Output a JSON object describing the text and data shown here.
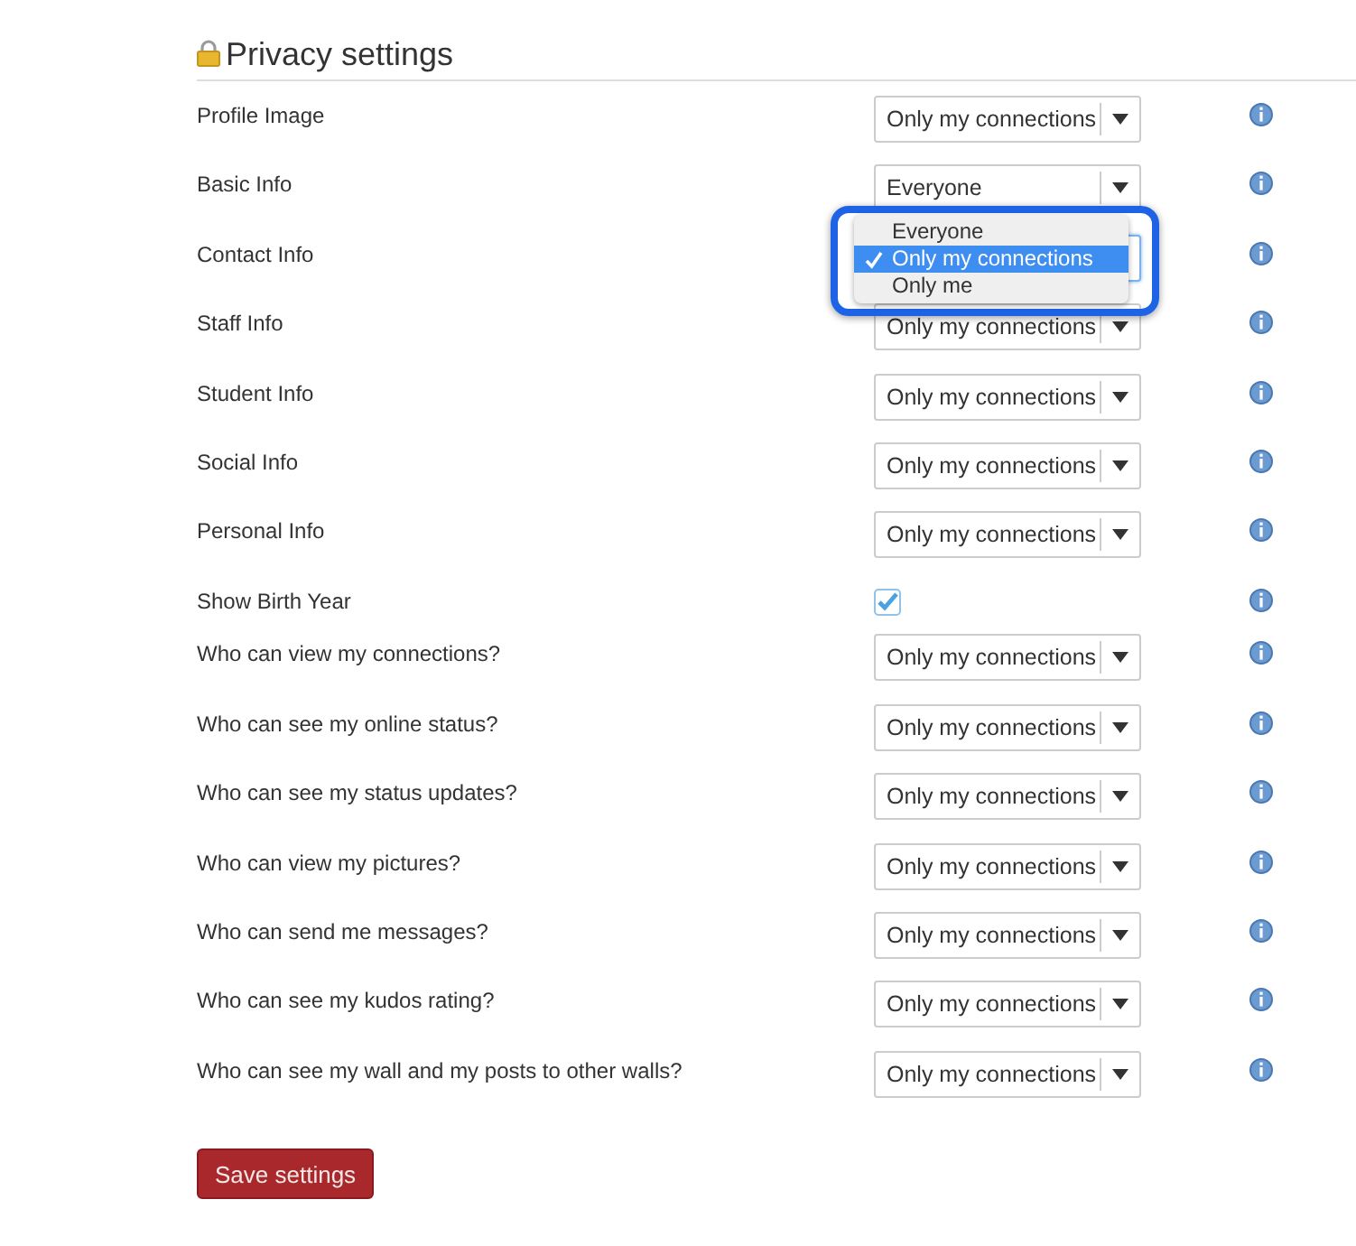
{
  "title": "Privacy settings",
  "rows": [
    {
      "label": "Profile Image",
      "kind": "select",
      "value": "Only my connections"
    },
    {
      "label": "Basic Info",
      "kind": "select",
      "value": "Everyone"
    },
    {
      "label": "Contact Info",
      "kind": "select",
      "open": true,
      "options": [
        {
          "label": "Everyone",
          "selected": false
        },
        {
          "label": "Only my connections",
          "selected": true
        },
        {
          "label": "Only me",
          "selected": false
        }
      ]
    },
    {
      "label": "Staff Info",
      "kind": "select",
      "value": "Only my connections"
    },
    {
      "label": "Student Info",
      "kind": "select",
      "value": "Only my connections"
    },
    {
      "label": "Social Info",
      "kind": "select",
      "value": "Only my connections"
    },
    {
      "label": "Personal Info",
      "kind": "select",
      "value": "Only my connections"
    },
    {
      "label": "Show Birth Year",
      "kind": "checkbox",
      "checked": true
    },
    {
      "label": "Who can view my connections?",
      "kind": "select",
      "value": "Only my connections"
    },
    {
      "label": "Who can see my online status?",
      "kind": "select",
      "value": "Only my connections"
    },
    {
      "label": "Who can see my status updates?",
      "kind": "select",
      "value": "Only my connections"
    },
    {
      "label": "Who can view my pictures?",
      "kind": "select",
      "value": "Only my connections"
    },
    {
      "label": "Who can send me messages?",
      "kind": "select",
      "value": "Only my connections"
    },
    {
      "label": "Who can see my kudos rating?",
      "kind": "select",
      "value": "Only my connections"
    },
    {
      "label": "Who can see my wall and my posts to other walls?",
      "kind": "select",
      "value": "Only my connections"
    }
  ],
  "save_button": "Save settings"
}
